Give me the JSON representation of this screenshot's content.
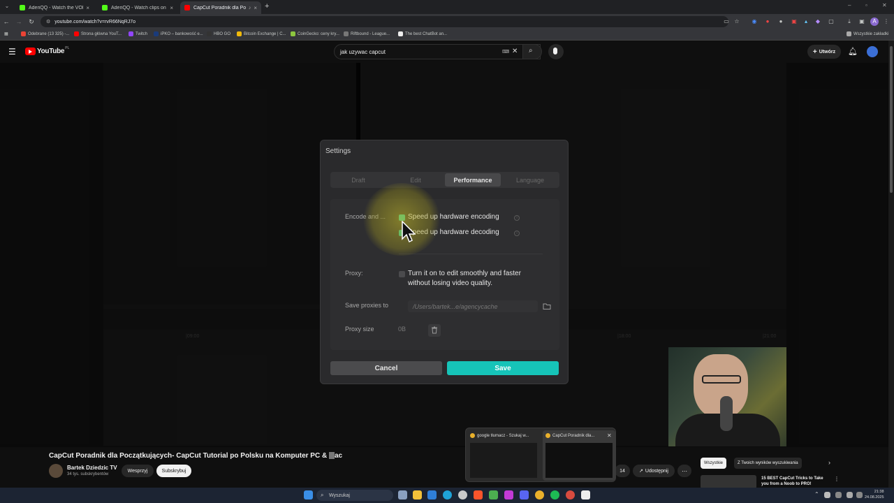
{
  "browser": {
    "tabs": [
      {
        "title": "AderiQQ - Watch the VOD on Kick",
        "favicon_color": "#53fc18"
      },
      {
        "title": "AderiQQ - Watch clips on Kick",
        "favicon_color": "#53fc18"
      },
      {
        "title": "CapCut Poradnik dla Początkujących",
        "favicon_color": "#ff0000"
      }
    ],
    "new_tab": "+",
    "url": "youtube.com/watch?v=rvR66NqRJ7o",
    "bookmarks": [
      "Odebrane (13 325) -...",
      "Strona główna YouT...",
      "Twitch",
      "iPKO – bankowość e...",
      "HBO GO",
      "Bitcoin Exchange | C...",
      "CoinGecko: ceny kry...",
      "Riftbound - League...",
      "The best ChatBot an..."
    ],
    "all_bookmarks": "Wszystkie zakładki"
  },
  "youtube": {
    "logo": "YouTube",
    "region": "PL",
    "search_query": "jak uzywac capcut",
    "create_label": "Utwórz"
  },
  "video": {
    "timeline_labels": [
      "|09:00",
      "|18:00",
      "|21:00"
    ]
  },
  "dialog": {
    "title": "Settings",
    "tabs": [
      "Draft",
      "Edit",
      "Performance",
      "Language"
    ],
    "active_tab": "Performance",
    "encode_label": "Encode and ...",
    "encode_option": "Speed up hardware encoding",
    "decode_option": "Speed up hardware decoding",
    "proxy_label": "Proxy:",
    "proxy_option_line1": "Turn it on to edit smoothly and faster",
    "proxy_option_line2": "without losing video quality.",
    "save_proxies_label": "Save proxies to",
    "save_proxies_path": "/Users/bartek...e/agencycache",
    "proxy_size_label": "Proxy size",
    "proxy_size_value": "0B",
    "cancel_label": "Cancel",
    "save_label": "Save",
    "accent_color": "#16c4b8",
    "checkbox_on_color": "#27c29a"
  },
  "watch": {
    "title": "CapCut Poradnik dla Początkujących- CapCut Tutorial po Polsku na Komputer PC & ",
    "title_end": "ac",
    "channel_name": "Bartek Dziedzic TV",
    "subscribers": "34 tys. subskrybentów",
    "support_label": "Wesprzyj",
    "subscribe_label": "Subskrybuj",
    "likes": "14",
    "share_label": "Udostępnij"
  },
  "taskbar_preview": {
    "items": [
      {
        "title": "google tłumacz - Szukaj w..."
      },
      {
        "title": "CapCut Poradnik dla..."
      }
    ]
  },
  "related": {
    "chips": [
      "Wszystkie",
      "Z Twoich wyników wyszukiwania"
    ],
    "video_title_line1": "15 BEST CapCut Tricks to Take",
    "video_title_line2": "you from a Noob to PRO!"
  },
  "windows": {
    "search_placeholder": "Wyszukaj",
    "time": "21:38",
    "date": "24.08.2025"
  }
}
